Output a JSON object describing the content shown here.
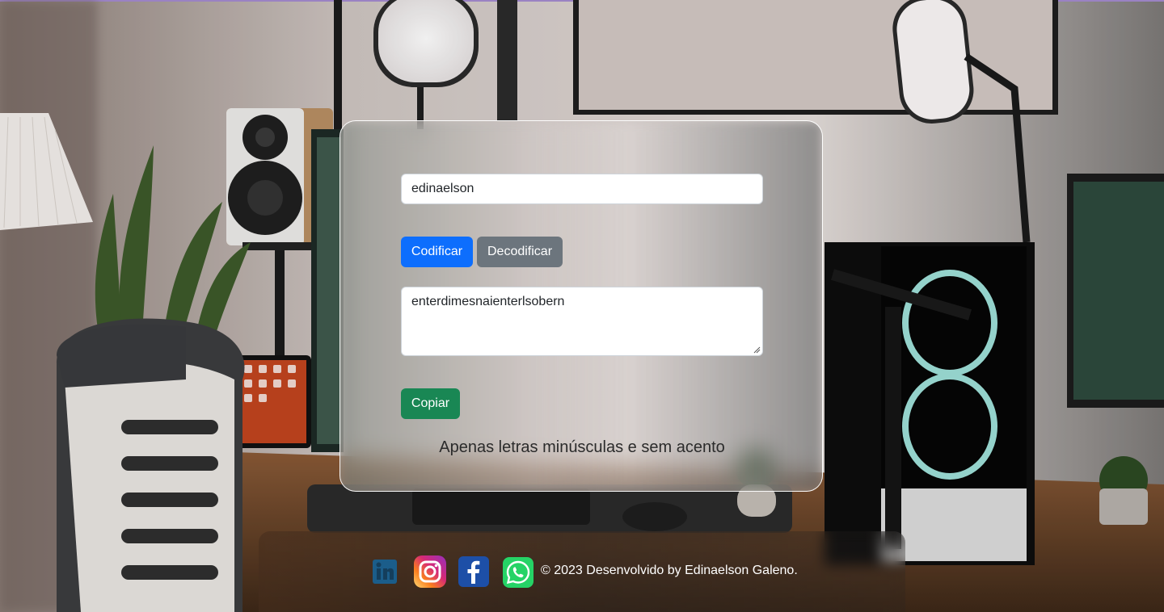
{
  "form": {
    "input_value": "edinaelson",
    "encode_label": "Codificar",
    "decode_label": "Decodificar",
    "output_value": "enterdimesnaienterlsobern",
    "copy_label": "Copiar",
    "hint": "Apenas letras minúsculas e sem acento"
  },
  "footer": {
    "copyright": "© 2023 Desenvolvido by Edinaelson Galeno.",
    "social": [
      {
        "name": "linkedin-icon",
        "color": "#1b5d8a"
      },
      {
        "name": "instagram-icon",
        "color": "#d62976"
      },
      {
        "name": "facebook-icon",
        "color": "#1877f2"
      },
      {
        "name": "whatsapp-icon",
        "color": "#25d366"
      }
    ]
  },
  "colors": {
    "primary": "#0d6efd",
    "secondary": "#6c757d",
    "success": "#198754"
  }
}
